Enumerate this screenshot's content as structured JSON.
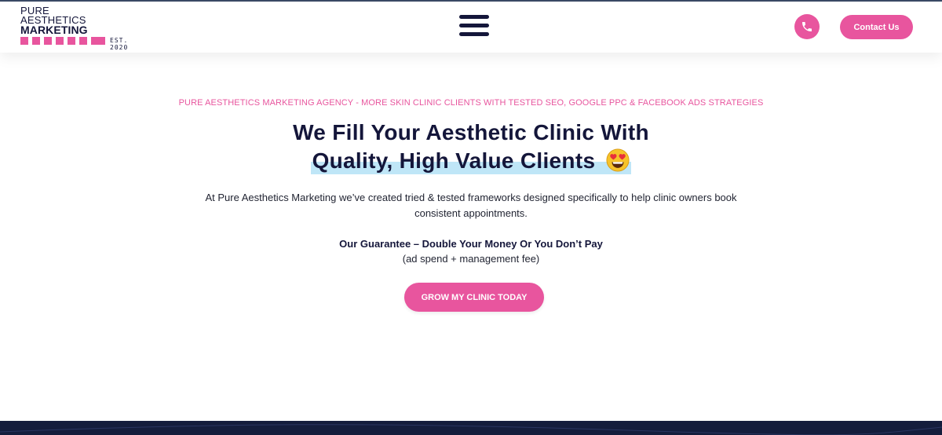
{
  "header": {
    "logo": {
      "line1": "PURE",
      "line2": "AESTHETICS",
      "line3": "MARKETING",
      "est": "EST. 2020"
    },
    "menu_icon": "hamburger-menu-icon",
    "phone_icon": "phone-icon",
    "contact_label": "Contact Us"
  },
  "hero": {
    "eyebrow": "PURE AESTHETICS MARKETING AGENCY - MORE SKIN CLINIC CLIENTS WITH TESTED SEO, GOOGLE PPC & FACEBOOK ADS STRATEGIES",
    "headline_line1": "We Fill Your Aesthetic Clinic With",
    "headline_line2": "Quality, High Value Clients",
    "emoji": "heart-eyes-emoji-icon",
    "intro_line1": "At Pure Aesthetics Marketing we’ve created tried & tested frameworks designed specifically to help clinic owners book",
    "intro_line2": "consistent appointments.",
    "guarantee": "Our Guarantee –  Double Your Money Or You Don’t Pay",
    "guarantee_sub": "(ad spend + management fee)",
    "cta_label": "GROW MY CLINIC TODAY"
  },
  "colors": {
    "brand_pink": "#e8559e",
    "navy": "#14163a",
    "highlight_blue": "#bfe6f7",
    "footer_navy": "#141d3c"
  }
}
